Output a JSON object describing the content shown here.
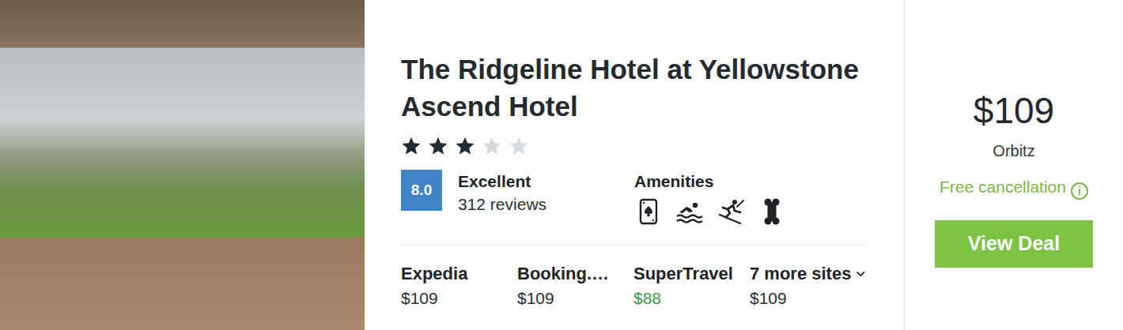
{
  "hotel": {
    "name": "The Ridgeline Hotel at Yellowstone Ascend Hotel",
    "stars": 3
  },
  "rating": {
    "score": "8.0",
    "label": "Excellent",
    "reviews": "312 reviews"
  },
  "amenities": {
    "title": "Amenities",
    "items": [
      {
        "kind": "casino"
      },
      {
        "kind": "pool"
      },
      {
        "kind": "ski"
      },
      {
        "kind": "pets"
      }
    ]
  },
  "providers": [
    {
      "name": "Expedia",
      "price": "$109",
      "best": false
    },
    {
      "name": "Booking.…",
      "price": "$109",
      "best": false
    },
    {
      "name": "SuperTravel",
      "price": "$88",
      "best": true
    }
  ],
  "more_sites": {
    "label": "7 more sites",
    "price": "$109",
    "expanded": false
  },
  "deal": {
    "price": "$109",
    "provider": "Orbitz",
    "cancellation": "Free cancellation",
    "info_icon": "i",
    "button": "View Deal"
  }
}
